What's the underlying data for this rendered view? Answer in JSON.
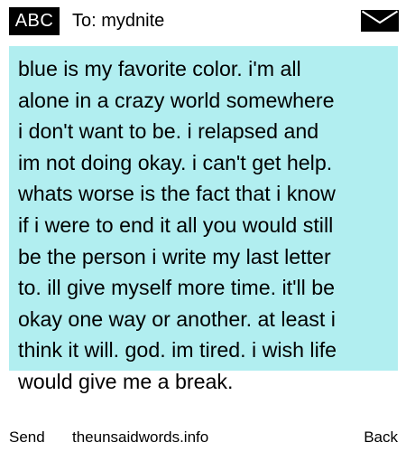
{
  "header": {
    "badge": "ABC",
    "to_line": "To: mydnite",
    "envelope_icon": "envelope-icon"
  },
  "message": {
    "body": "blue is my favorite color. i'm all\nalone in a crazy world somewhere\ni don't want to be. i relapsed and\nim not doing okay. i can't get help.\nwhats worse is the fact that i know\nif i were to end it all you would still\nbe the person i write my last letter\nto. ill give myself more time. it'll be\nokay one way or another. at least i\nthink it will. god. im tired. i wish life\nwould give me a break."
  },
  "footer": {
    "send_label": "Send",
    "site": "theunsaidwords.info",
    "back_label": "Back"
  },
  "colors": {
    "highlight": "#b1eef0",
    "badge_bg": "#000000"
  }
}
